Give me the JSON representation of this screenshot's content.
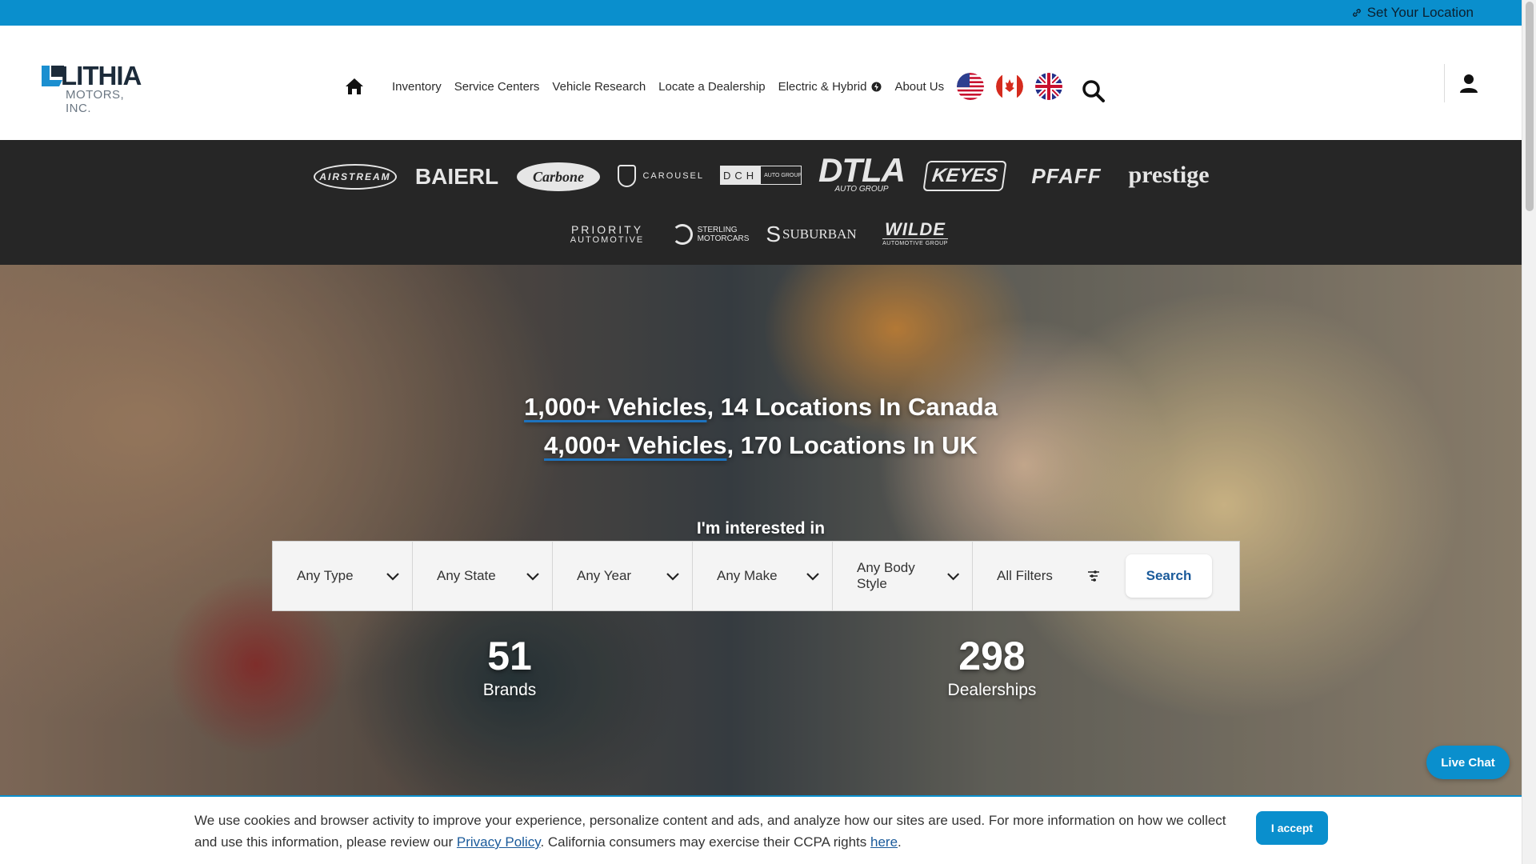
{
  "topbar": {
    "set_location": "Set Your Location"
  },
  "logo": {
    "name": "LITHIA",
    "sub": "MOTORS, INC."
  },
  "nav": {
    "items": [
      "Inventory",
      "Service Centers",
      "Vehicle Research",
      "Locate a Dealership",
      "Electric & Hybrid",
      "About Us"
    ],
    "flags": [
      "us-flag",
      "canada-flag",
      "uk-flag"
    ]
  },
  "brands": {
    "airstream": "AIRSTREAM",
    "baierl": "BAIERL",
    "carbone": "Carbone",
    "carousel": "CAROUSEL",
    "dch_left": "DCH",
    "dch_right": "AUTO GROUP",
    "dtla": "DTLA",
    "dtla_sub": "AUTO GROUP",
    "keyes": "KEYES",
    "pfaff": "PFAFF",
    "prestige": "prestige",
    "priority": "PRIORITY",
    "priority_sub": "AUTOMOTIVE",
    "sterling": "STERLING",
    "sterling_sub": "MOTORCARS",
    "suburban": "SUBURBAN",
    "wilde": "WILDE",
    "wilde_sub": "AUTOMOTIVE GROUP"
  },
  "hero": {
    "line1_link": "1,000+ Vehicles",
    "line1_rest": ", 14 Locations In Canada",
    "line2_link": "4,000+ Vehicles",
    "line2_rest": ", 170 Locations In UK",
    "interested": "I'm interested in",
    "filters": [
      "Any Type",
      "Any State",
      "Any Year",
      "Any Make",
      "Any Body Style",
      "All Filters"
    ],
    "search": "Search",
    "stats": [
      {
        "num": "51",
        "label": "Brands"
      },
      {
        "num": "298",
        "label": "Dealerships"
      }
    ]
  },
  "live_chat": "Live Chat",
  "cookie": {
    "text1": "We use cookies and browser activity to improve your experience, personalize content and ads, and analyze how our sites are used. For more information on how we collect and use this information, please review our ",
    "privacy": "Privacy Policy",
    "text2": ". California consumers may exercise their CCPA rights ",
    "here": "here",
    "text3": ".",
    "accept": "I accept"
  },
  "colors": {
    "accent": "#0a8fcd",
    "brand_strip": "#262626",
    "link": "#1a5a9a"
  }
}
